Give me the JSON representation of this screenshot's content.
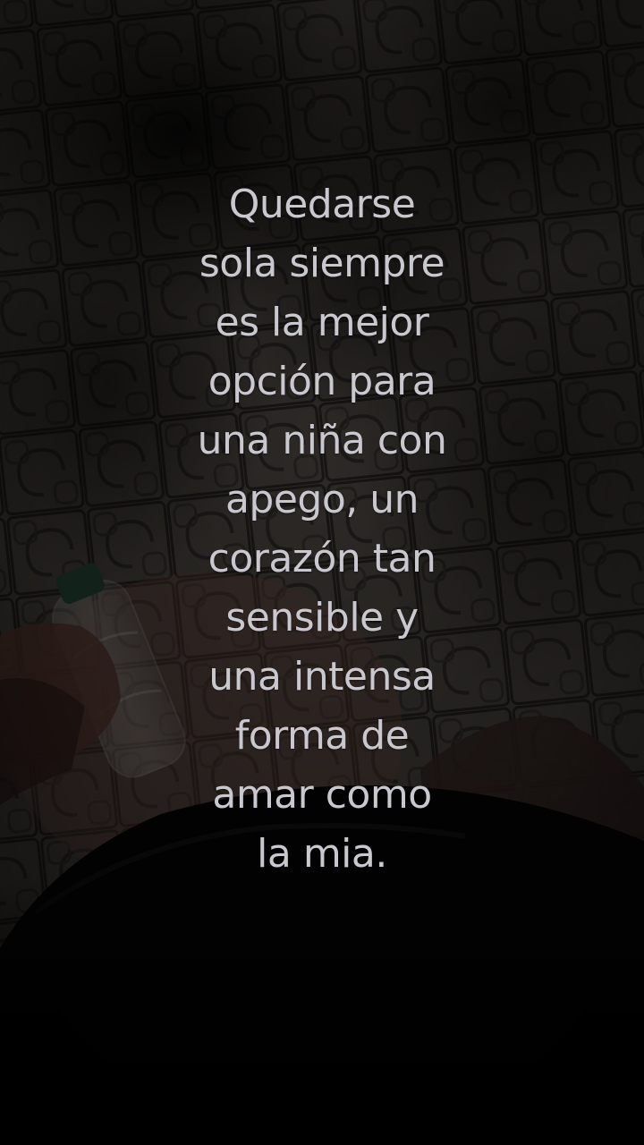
{
  "caption": {
    "lines": [
      "Quedarse",
      "sola siempre",
      "es la mejor",
      "opción para",
      "una niña con",
      "apego, un",
      "corazón tan",
      "sensible y",
      "una intensa",
      "forma de",
      "amar como",
      "la mia."
    ]
  },
  "colors": {
    "caption_text": "#c9c8cf",
    "floor_tiles": "#3a3632",
    "background_dark": "#0b0b0b"
  }
}
